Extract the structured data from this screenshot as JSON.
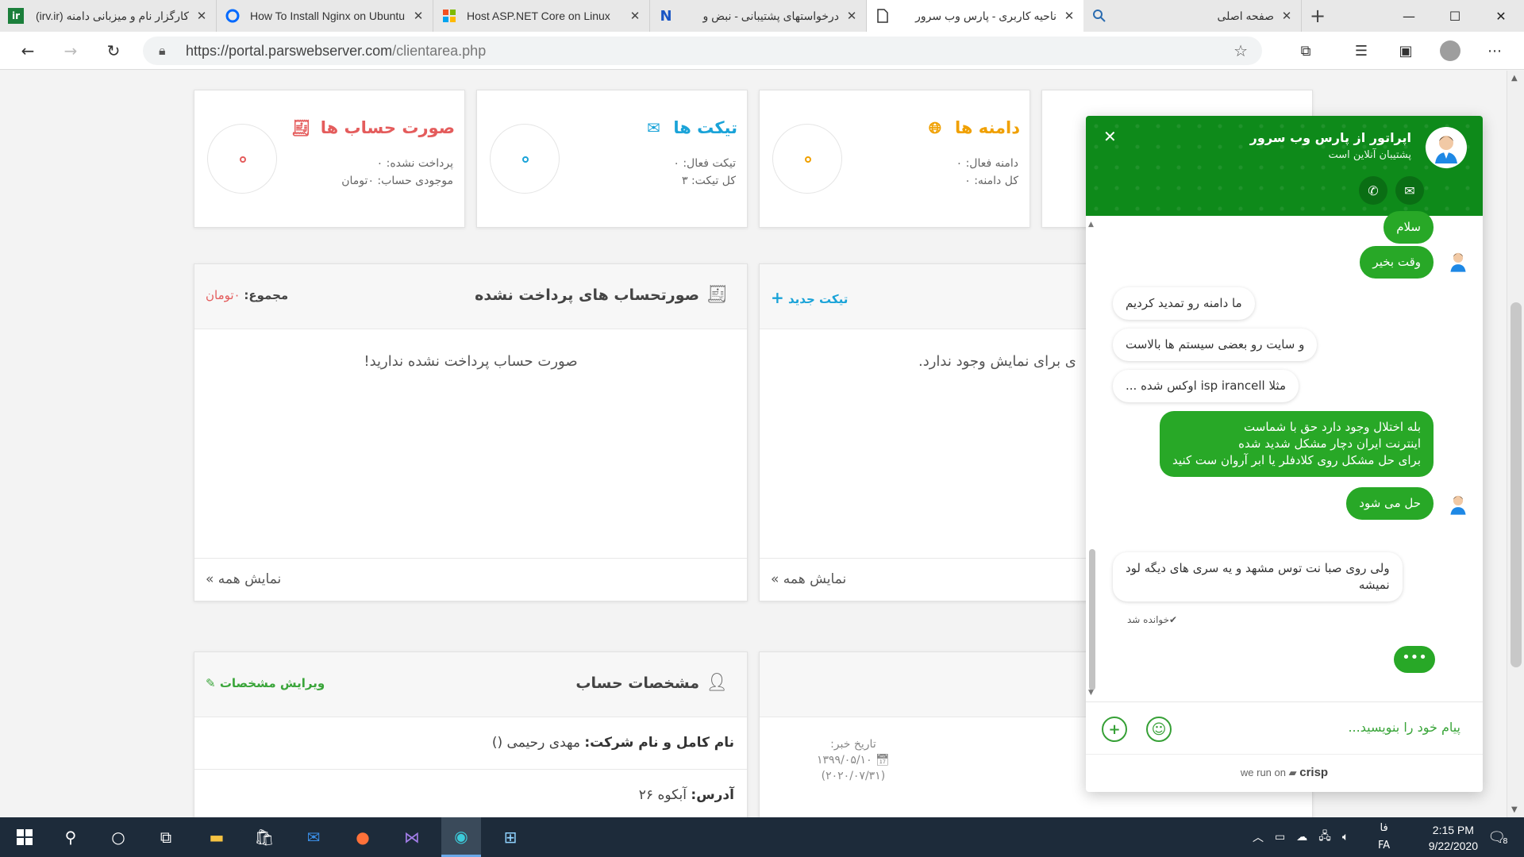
{
  "browser": {
    "tabs": [
      {
        "title": "کارگزار نام و میزبانی دامنه (irv.ir)",
        "favicon": "ir",
        "fav_color": "#1b7f3b",
        "active": false
      },
      {
        "title": "How To Install Nginx on Ubuntu",
        "favicon": "digitalocean-icon",
        "fav_color": "#0069ff",
        "active": false
      },
      {
        "title": "Host ASP.NET Core on Linux",
        "favicon": "microsoft-icon",
        "fav_color": "#f25022",
        "active": false
      },
      {
        "title": "درخواستهای پشتیبانی - نبض و",
        "favicon": "N",
        "fav_color": "#1a56c4",
        "active": false
      },
      {
        "title": "ناحیه کاربری - پارس وب سرور",
        "favicon": "page-icon",
        "fav_color": "#333333",
        "active": true
      },
      {
        "title": "صفحه اصلی",
        "favicon": "search-icon",
        "fav_color": "#2b6cb0",
        "active": false
      }
    ],
    "url_main": "https://portal.parswebserver.com",
    "url_path": "/clientarea.php"
  },
  "stats": {
    "invoices": {
      "title": "صورت حساب ها",
      "line1": "پرداخت نشده: ۰",
      "line2": "موجودی حساب: ۰تومان",
      "color": "#e45c5c"
    },
    "tickets": {
      "title": "تیکت ها",
      "line1": "تیکت فعال: ۰",
      "line2": "کل تیکت: ۳",
      "color": "#1aa3d8"
    },
    "domains": {
      "title": "دامنه ها",
      "line1": "دامنه فعال: ۰",
      "line2": "کل دامنه: ۰",
      "color": "#f0a000"
    }
  },
  "invoices_panel": {
    "title": "صورتحساب های پرداخت نشده",
    "total_label": "مجموع:",
    "total_value": "۰تومان",
    "empty": "صورت حساب پرداخت نشده ندارید!",
    "view_all": "نمایش همه »"
  },
  "tickets_panel": {
    "new_ticket": "تیکت جدید",
    "empty": "ی برای نمایش وجود ندارد.",
    "view_all": "نمایش همه »"
  },
  "account_panel": {
    "title": "مشخصات حساب",
    "edit": "ویرایش مشخصات",
    "name_label": "نام کامل و نام شرکت:",
    "name_value": "مهدی رحیمی ()",
    "address_label": "آدرس:",
    "address_value": "آبکوه ۲۶"
  },
  "news_panel": {
    "date_label": "تاریخ خبر:",
    "date_fa": "۱۳۹۹/۰۵/۱۰",
    "date_en": "(۲۰۲۰/۰۷/۳۱)"
  },
  "chat": {
    "operator": "اپراتور از پارس وب سرور",
    "status": "پشتیبان آنلاین است",
    "messages": [
      {
        "from": "operator",
        "text": "سلام"
      },
      {
        "from": "operator",
        "text": "وقت بخیر"
      },
      {
        "from": "user",
        "text": "ما دامنه رو تمدید کردیم"
      },
      {
        "from": "user",
        "text": "و سایت رو بعضی سیستم ها بالاست"
      },
      {
        "from": "user",
        "text": "مثلا isp irancell اوکس شده ..."
      },
      {
        "from": "operator",
        "text": "بله اختلال وجود دارد حق با شماست"
      },
      {
        "from": "operator",
        "text": "اینترنت ایران دچار مشکل شدید شده"
      },
      {
        "from": "operator",
        "text": "برای حل مشکل روی کلادفلر یا ابر آروان ست کنید"
      },
      {
        "from": "operator",
        "text": "حل می شود"
      },
      {
        "from": "user",
        "text": "ولی روی صبا نت توس مشهد و یه سری های دیگه لود"
      },
      {
        "from": "user",
        "text": "نمیشه"
      }
    ],
    "read_receipt": "✔خوانده شد",
    "typing": "•••",
    "input_placeholder": "پیام خود را بنویسید...",
    "footer_prefix": "we run on",
    "footer_brand": "crisp"
  },
  "taskbar": {
    "time": "2:15 PM",
    "date": "9/22/2020",
    "lang_top": "فا",
    "lang_bottom": "FA",
    "notif_count": "8"
  }
}
